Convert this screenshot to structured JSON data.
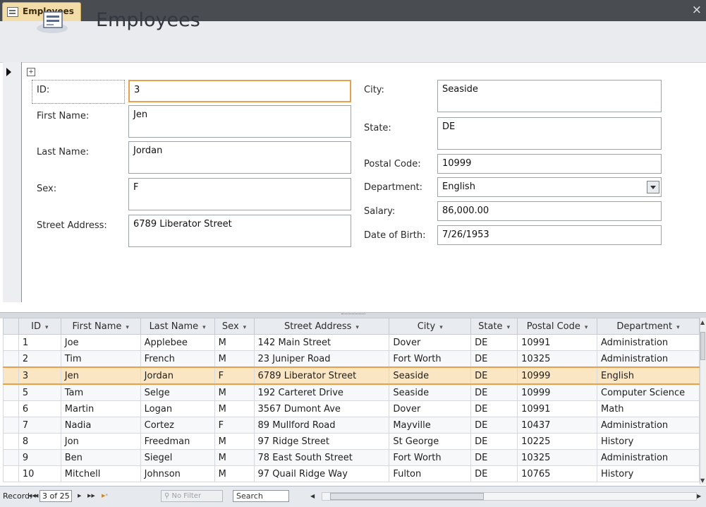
{
  "tab": {
    "label": "Employees",
    "close": "×"
  },
  "header": {
    "title": "Employees"
  },
  "form": {
    "id": {
      "label": "ID:",
      "value": "3"
    },
    "first_name": {
      "label": "First Name:",
      "value": "Jen"
    },
    "last_name": {
      "label": "Last Name:",
      "value": "Jordan"
    },
    "sex": {
      "label": "Sex:",
      "value": "F"
    },
    "street_address": {
      "label": "Street Address:",
      "value": "6789 Liberator Street"
    },
    "city": {
      "label": "City:",
      "value": "Seaside"
    },
    "state": {
      "label": "State:",
      "value": "DE"
    },
    "postal_code": {
      "label": "Postal Code:",
      "value": "10999"
    },
    "department": {
      "label": "Department:",
      "value": "English"
    },
    "salary": {
      "label": "Salary:",
      "value": "86,000.00"
    },
    "date_of_birth": {
      "label": "Date of Birth:",
      "value": "7/26/1953"
    }
  },
  "datasheet": {
    "columns": [
      "ID",
      "First Name",
      "Last Name",
      "Sex",
      "Street Address",
      "City",
      "State",
      "Postal Code",
      "Department"
    ],
    "rows": [
      [
        "1",
        "Joe",
        "Applebee",
        "M",
        "142 Main Street",
        "Dover",
        "DE",
        "10991",
        "Administration"
      ],
      [
        "2",
        "Tim",
        "French",
        "M",
        "23 Juniper Road",
        "Fort Worth",
        "DE",
        "10325",
        "Administration"
      ],
      [
        "3",
        "Jen",
        "Jordan",
        "F",
        "6789 Liberator Street",
        "Seaside",
        "DE",
        "10999",
        "English"
      ],
      [
        "5",
        "Tam",
        "Selge",
        "M",
        "192 Carteret Drive",
        "Seaside",
        "DE",
        "10999",
        "Computer Science"
      ],
      [
        "6",
        "Martin",
        "Logan",
        "M",
        "3567 Dumont Ave",
        "Dover",
        "DE",
        "10991",
        "Math"
      ],
      [
        "7",
        "Nadia",
        "Cortez",
        "F",
        "89 Mullford Road",
        "Mayville",
        "DE",
        "10437",
        "Administration"
      ],
      [
        "8",
        "Jon",
        "Freedman",
        "M",
        "97 Ridge Street",
        "St George",
        "DE",
        "10225",
        "History"
      ],
      [
        "9",
        "Ben",
        "Siegel",
        "M",
        "78 East South Street",
        "Fort Worth",
        "DE",
        "10325",
        "Administration"
      ],
      [
        "10",
        "Mitchell",
        "Johnson",
        "M",
        "97 Quail Ridge Way",
        "Fulton",
        "DE",
        "10765",
        "History"
      ]
    ],
    "current_row_index": 2
  },
  "navigation": {
    "record_label": "Record:",
    "first": "◀◀",
    "prev": "◀",
    "position": "3 of 25",
    "next": "▶",
    "last": "▶▶",
    "new": "▶*",
    "filter_status": "No Filter",
    "search": "Search"
  },
  "colors": {
    "accent": "#e8a04b",
    "tab_bg": "#494d52",
    "doc_tab": "#f2dca8"
  }
}
